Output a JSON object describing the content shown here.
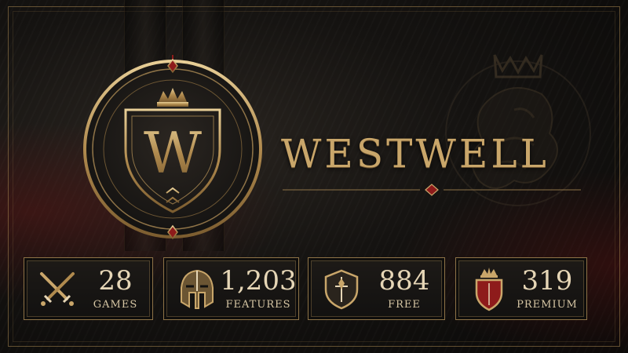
{
  "brand": {
    "title": "WESTWELL",
    "emblem_letter": "W",
    "accent_gold": "#c9a66a",
    "accent_red": "#8e1b1b"
  },
  "stats": [
    {
      "value": "28",
      "label": "GAMES",
      "icon": "crossed-swords-icon"
    },
    {
      "value": "1,203",
      "label": "FEATURES",
      "icon": "spartan-helmet-icon"
    },
    {
      "value": "884",
      "label": "FREE",
      "icon": "shield-icon"
    },
    {
      "value": "319",
      "label": "PREMIUM",
      "icon": "crowned-red-shield-icon"
    }
  ]
}
